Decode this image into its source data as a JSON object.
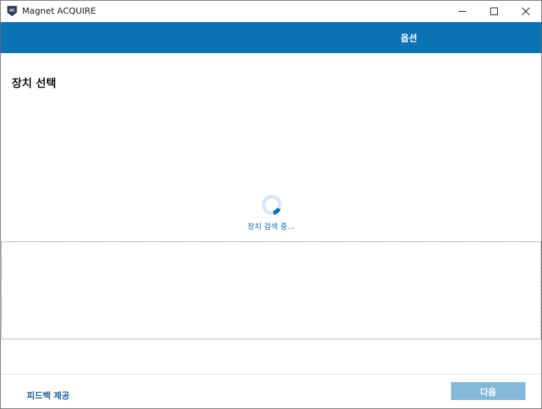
{
  "window": {
    "title": "Magnet ACQUIRE",
    "icon": "magnet-acquire-logo",
    "icon_text": "AC",
    "controls": [
      "minimize-icon",
      "maximize-icon",
      "close-icon"
    ]
  },
  "header": {
    "options_label": "옵션",
    "band_color": "#0a72b5"
  },
  "page": {
    "title": "장치 선택"
  },
  "status": {
    "searching_text": "장치 검색 중...",
    "spinner_icon": "loading-spinner-icon",
    "accent_color": "#0a72b5"
  },
  "device_list": {
    "items": []
  },
  "footer": {
    "feedback_label": "피드백 제공",
    "next_label": "다음",
    "next_enabled": false,
    "next_color": "#84b8d8"
  }
}
